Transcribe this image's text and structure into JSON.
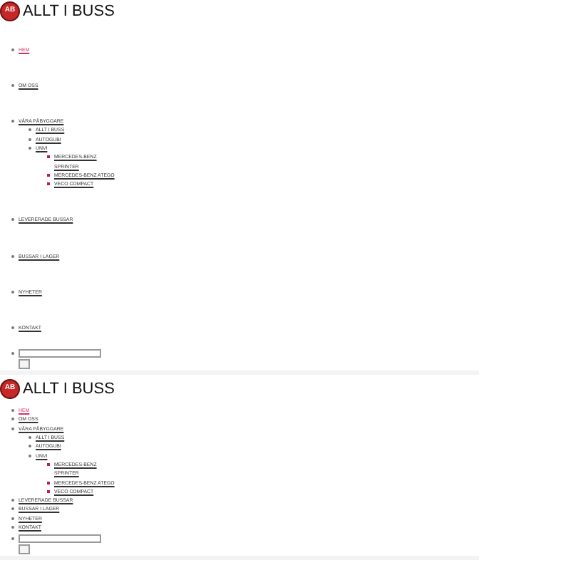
{
  "headers": [
    {
      "spaced": true,
      "logo_mark": "AB",
      "title": "ALLT I BUSS",
      "menu": [
        {
          "label": "HEM",
          "selected": true
        },
        {
          "label": "OM OSS",
          "selected": false
        },
        {
          "label": "VÅRA PÅBYGGARE",
          "selected": false,
          "children": [
            {
              "label": "ALLT I BUSS",
              "selected": false
            },
            {
              "label": "AUTOGUBI",
              "selected": false
            },
            {
              "label": "UNVI",
              "selected": false,
              "children": [
                {
                  "label": "MERCEDES-BENZ SPRINTER",
                  "selected": false
                },
                {
                  "label": "MERCEDES-BENZ ATEGO",
                  "selected": false
                },
                {
                  "label": "VECO COMPACT",
                  "selected": false
                }
              ]
            }
          ]
        },
        {
          "label": "LEVERERADE BUSSAR",
          "selected": false
        },
        {
          "label": "BUSSAR I LAGER",
          "selected": false
        },
        {
          "label": "NYHETER",
          "selected": false
        },
        {
          "label": "KONTAKT",
          "selected": false
        }
      ]
    },
    {
      "spaced": false,
      "logo_mark": "AB",
      "title": "ALLT I BUSS",
      "menu": [
        {
          "label": "HEM",
          "selected": true
        },
        {
          "label": "OM OSS",
          "selected": false
        },
        {
          "label": "VÅRA PÅBYGGARE",
          "selected": false,
          "children": [
            {
              "label": "ALLT I BUSS",
              "selected": false
            },
            {
              "label": "AUTOGUBI",
              "selected": false
            },
            {
              "label": "UNVI",
              "selected": false,
              "children": [
                {
                  "label": "MERCEDES-BENZ SPRINTER",
                  "selected": false
                },
                {
                  "label": "MERCEDES-BENZ ATEGO",
                  "selected": false
                },
                {
                  "label": "VECO COMPACT",
                  "selected": false
                }
              ]
            }
          ]
        },
        {
          "label": "LEVERERADE BUSSAR",
          "selected": false
        },
        {
          "label": "BUSSAR I LAGER",
          "selected": false
        },
        {
          "label": "NYHETER",
          "selected": false
        },
        {
          "label": "KONTAKT",
          "selected": false
        }
      ]
    }
  ]
}
